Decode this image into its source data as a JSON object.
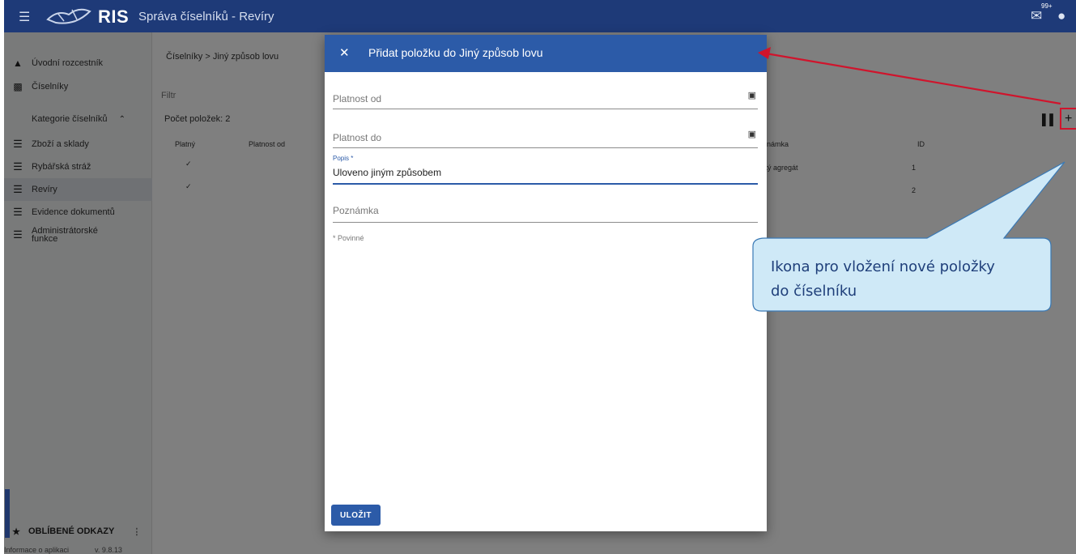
{
  "topbar": {
    "menu_icon": "hamburger-icon",
    "logo_text": "RIS",
    "app_title": "Správa číselníků - Revíry",
    "messages_badge": "99+",
    "messages_icon": "messages-icon",
    "user_icon": "user-icon"
  },
  "sidebar": {
    "items": [
      {
        "label": "Úvodní rozcestník",
        "icon": "home-icon"
      },
      {
        "label": "Číselníky",
        "icon": "grid-icon"
      },
      {
        "label": "Kategorie číselníků",
        "icon": "chevron-up-icon"
      },
      {
        "label": "Zboží a sklady",
        "icon": "list-icon"
      },
      {
        "label": "Rybářská stráž",
        "icon": "list-icon"
      },
      {
        "label": "Revíry",
        "icon": "list-icon"
      },
      {
        "label": "Evidence dokumentů",
        "icon": "list-icon"
      },
      {
        "label": "Administrátorské funkce",
        "icon": "list-icon"
      }
    ],
    "favorites_label": "OBLÍBENÉ ODKAZY",
    "favorites_icon": "star-icon",
    "footer_info": "Informace o aplikaci",
    "footer_version": "v. 9.8.13"
  },
  "main": {
    "breadcrumb_root": "Číselníky",
    "breadcrumb_sep": ">",
    "breadcrumb_current": "Jiný způsob lovu",
    "filter_placeholder": "Filtr",
    "count_label": "Počet položek: 2",
    "columns": [
      "Platný",
      "Platnost od",
      "námka",
      "ID"
    ],
    "rows": [
      {
        "valid": "✓",
        "note": "cký agregát",
        "id": "1"
      },
      {
        "valid": "✓",
        "note": "",
        "id": "2"
      }
    ],
    "columns_icon": "columns-icon",
    "add_icon": "plus-icon"
  },
  "modal": {
    "title": "Přidat položku do Jiný způsob lovu",
    "close_icon": "close-icon",
    "valid_from_placeholder": "Platnost od",
    "valid_to_placeholder": "Platnost do",
    "description_label": "Popis *",
    "description_value": "Uloveno jiným způsobem",
    "note_placeholder": "Poznámka",
    "required_note": "* Povinné",
    "save_label": "ULOŽIT"
  },
  "annotation": {
    "callout_line1": "Ikona pro vložení nové položky",
    "callout_line2": "do číselníku",
    "arrow_color": "#d0142c",
    "callout_fill": "#cfe9f7"
  }
}
